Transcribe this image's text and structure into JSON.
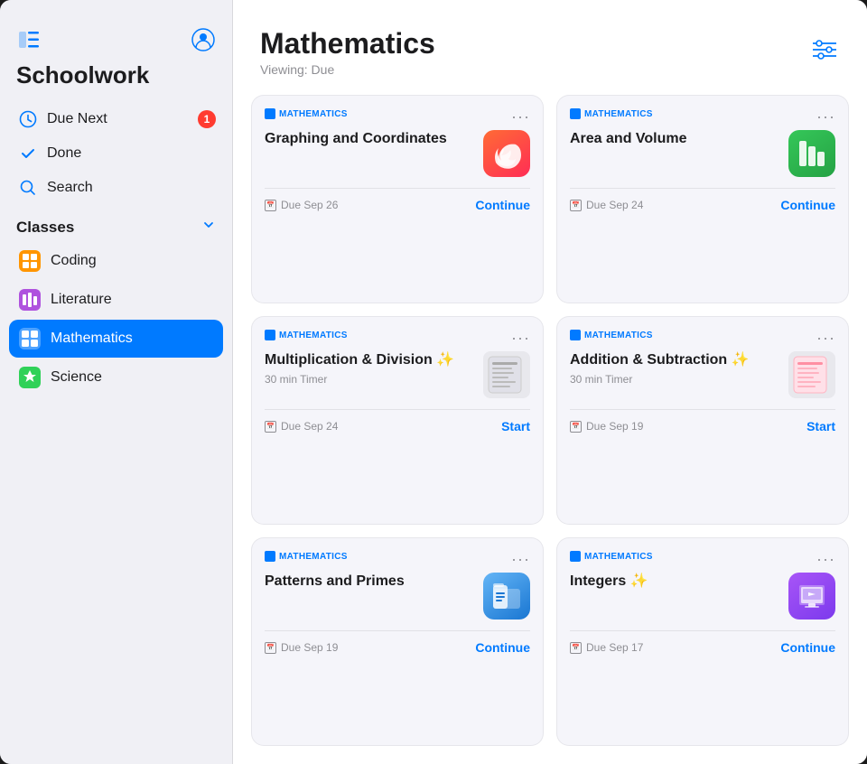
{
  "app": {
    "title": "Schoolwork"
  },
  "sidebar": {
    "title": "Schoolwork",
    "nav_items": [
      {
        "id": "due-next",
        "label": "Due Next",
        "icon": "clock",
        "badge": "1"
      },
      {
        "id": "done",
        "label": "Done",
        "icon": "checkmark"
      },
      {
        "id": "search",
        "label": "Search",
        "icon": "magnify"
      }
    ],
    "classes_section": "Classes",
    "classes": [
      {
        "id": "coding",
        "label": "Coding",
        "icon": "orange-grid",
        "active": false
      },
      {
        "id": "literature",
        "label": "Literature",
        "icon": "purple-bar",
        "active": false
      },
      {
        "id": "mathematics",
        "label": "Mathematics",
        "icon": "blue-grid",
        "active": true
      },
      {
        "id": "science",
        "label": "Science",
        "icon": "green-star",
        "active": false
      }
    ]
  },
  "main": {
    "title": "Mathematics",
    "viewing_label": "Viewing: Due",
    "filter_label": "Filter",
    "assignments": [
      {
        "id": "graphing",
        "subject": "MATHEMATICS",
        "title": "Graphing and Coordinates",
        "subtitle": "",
        "app_icon": "swift",
        "due": "Due Sep 26",
        "action": "Continue",
        "action_type": "continue"
      },
      {
        "id": "area-volume",
        "subject": "MATHEMATICS",
        "title": "Area and Volume",
        "subtitle": "",
        "app_icon": "numbers",
        "due": "Due Sep 24",
        "action": "Continue",
        "action_type": "continue"
      },
      {
        "id": "multiplication",
        "subject": "MATHEMATICS",
        "title": "Multiplication & Division ✨",
        "subtitle": "30 min Timer",
        "app_icon": "thumbnail-doc",
        "due": "Due Sep 24",
        "action": "Start",
        "action_type": "start"
      },
      {
        "id": "addition",
        "subject": "MATHEMATICS",
        "title": "Addition & Subtraction ✨",
        "subtitle": "30 min Timer",
        "app_icon": "thumbnail-doc2",
        "due": "Due Sep 19",
        "action": "Start",
        "action_type": "start"
      },
      {
        "id": "patterns",
        "subject": "MATHEMATICS",
        "title": "Patterns and Primes",
        "subtitle": "",
        "app_icon": "files",
        "due": "Due Sep 19",
        "action": "Continue",
        "action_type": "continue"
      },
      {
        "id": "integers",
        "subject": "MATHEMATICS",
        "title": "Integers ✨",
        "subtitle": "",
        "app_icon": "keynote",
        "due": "Due Sep 17",
        "action": "Continue",
        "action_type": "continue"
      }
    ]
  }
}
